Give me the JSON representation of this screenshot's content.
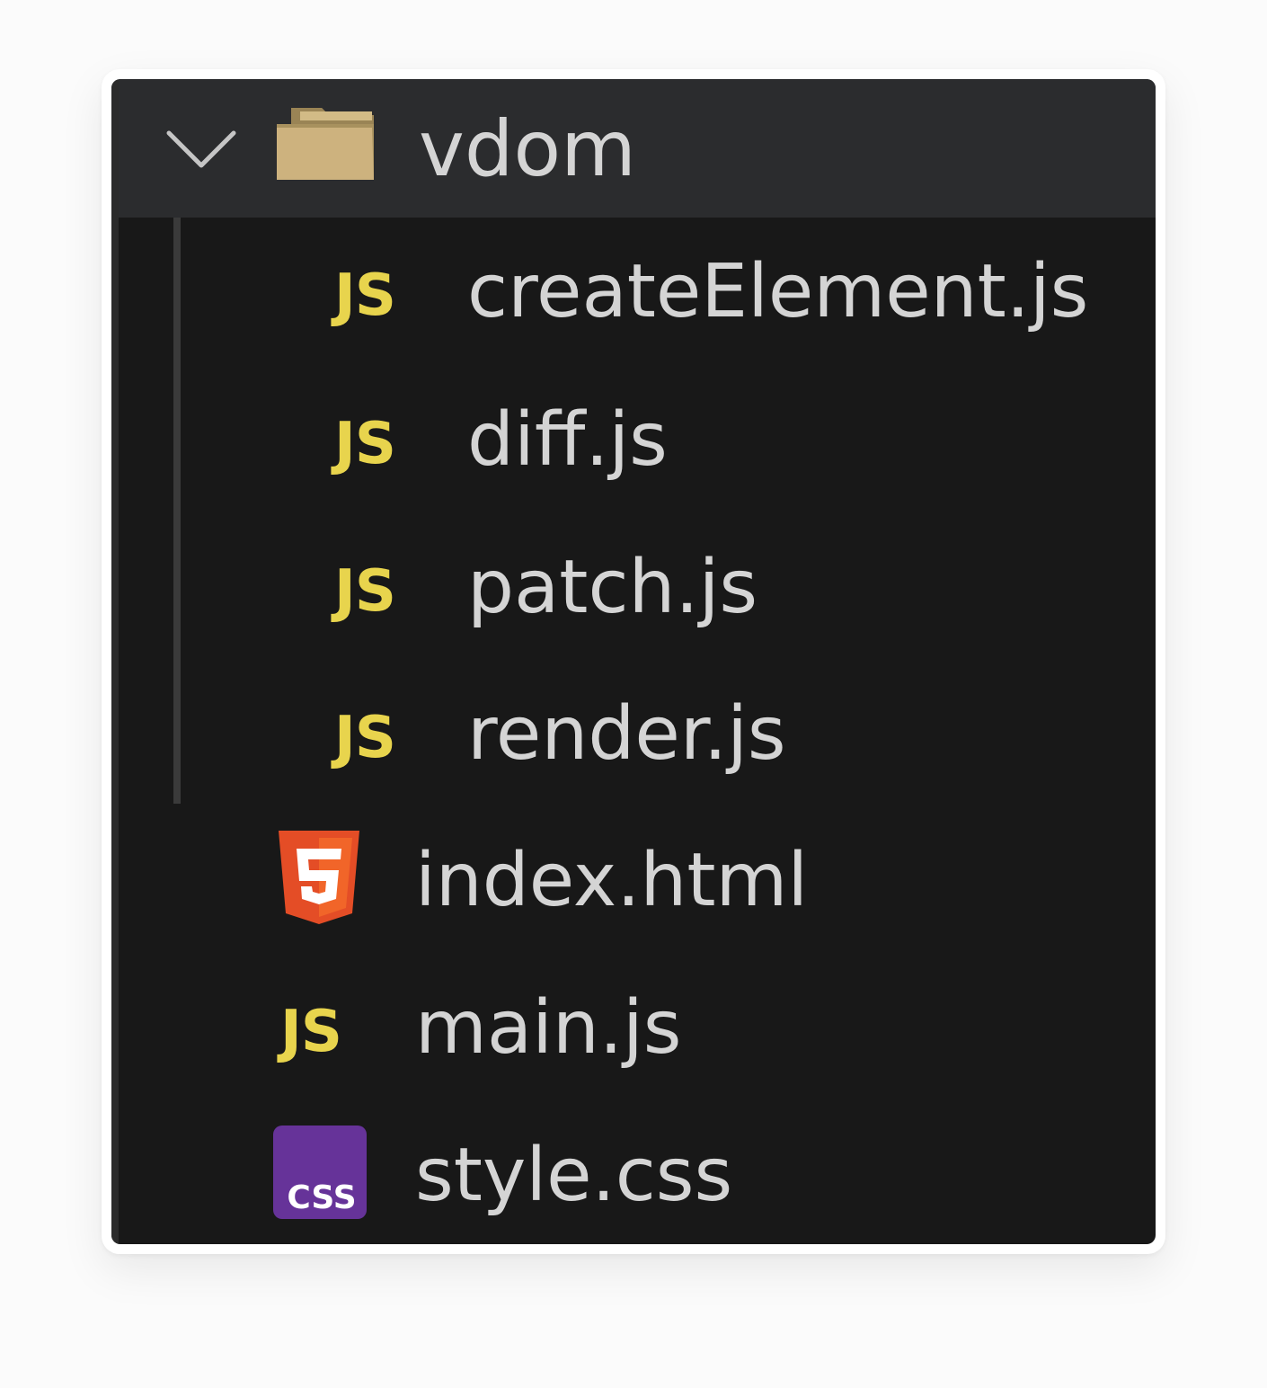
{
  "explorer": {
    "folder": {
      "name": "vdom",
      "expanded": true,
      "children": [
        {
          "name": "createElement.js",
          "icon": "js-icon",
          "badge": "JS"
        },
        {
          "name": "diff.js",
          "icon": "js-icon",
          "badge": "JS"
        },
        {
          "name": "patch.js",
          "icon": "js-icon",
          "badge": "JS"
        },
        {
          "name": "render.js",
          "icon": "js-icon",
          "badge": "JS"
        }
      ]
    },
    "files": [
      {
        "name": "index.html",
        "icon": "html5-icon"
      },
      {
        "name": "main.js",
        "icon": "js-icon",
        "badge": "JS"
      },
      {
        "name": "style.css",
        "icon": "css-icon",
        "badge": "CSS"
      }
    ]
  },
  "colors": {
    "background": "#181818",
    "folder_row": "#2b2c2e",
    "text": "#d4d4d4",
    "js": "#e8d44d",
    "html": "#e44d26",
    "css": "#663399",
    "folder": "#c8b07a"
  }
}
